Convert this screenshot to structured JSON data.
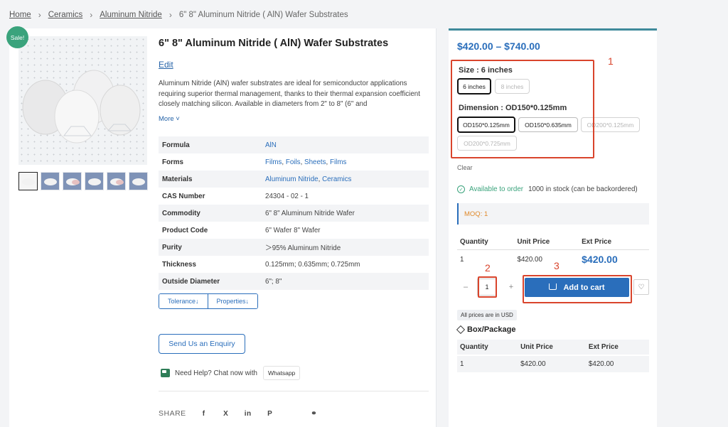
{
  "breadcrumb": {
    "home": "Home",
    "sep": "›",
    "ceramics": "Ceramics",
    "aluminum_nitride": "Aluminum Nitride",
    "current": "6\" 8\" Aluminum Nitride ( AlN) Wafer Substrates"
  },
  "badge": {
    "sale": "Sale!"
  },
  "product": {
    "title": "6\" 8\" Aluminum Nitride ( AlN) Wafer Substrates",
    "edit_label": "Edit",
    "description": "Aluminum Nitride (AlN) wafer substrates are ideal for semiconductor applications requiring superior thermal management, thanks to their thermal expansion coefficient closely matching silicon. Available in diameters from 2\" to 8\" (6\" and",
    "more_label": "More ˅"
  },
  "specs": {
    "formula": {
      "label": "Formula",
      "value": "AlN"
    },
    "forms": {
      "label": "Forms",
      "v1": "Films",
      "v2": "Foils",
      "v3": "Sheets",
      "v4": "Films",
      "comma": ","
    },
    "materials": {
      "label": "Materials",
      "v1": "Aluminum Nitride",
      "v2": "Ceramics"
    },
    "cas": {
      "label": "CAS Number",
      "value": "24304 - 02 - 1"
    },
    "commodity": {
      "label": "Commodity",
      "value": "6\" 8\" Aluminum Nitride Wafer"
    },
    "product_code": {
      "label": "Product Code",
      "value": "6\" Wafer 8\" Wafer"
    },
    "purity": {
      "label": "Purity",
      "value": "＞95% Aluminum Nitride"
    },
    "thickness": {
      "label": "Thickness",
      "value": "0.125mm; 0.635mm; 0.725mm"
    },
    "outside_diameter": {
      "label": "Outside Diameter",
      "value": "6\"; 8\""
    }
  },
  "tabs": {
    "tolerance": "Tolerance↓",
    "properties": "Properties↓"
  },
  "enquiry": {
    "label": "Send Us an Enquiry"
  },
  "help": {
    "text": "Need Help? Chat now with",
    "whatsapp": "Whatsapp"
  },
  "share": {
    "label": "SHARE",
    "facebook": "f",
    "x": "X",
    "linkedin": "in",
    "pinterest": "P",
    "link": "⚭"
  },
  "pricing": {
    "range": "$420.00 – $740.00"
  },
  "variations": {
    "size_label": "Size : 6 inches",
    "size_options": [
      "6 inches",
      "8 inches"
    ],
    "dimension_label": "Dimension : OD150*0.125mm",
    "dimension_options": [
      "OD150*0.125mm",
      "OD150*0.635mm",
      "OD200*0.125mm",
      "OD200*0.725mm"
    ],
    "clear": "Clear"
  },
  "stock": {
    "check": "✓",
    "status": "Available to order",
    "qty": "1000 in stock (can be backordered)"
  },
  "moq": {
    "text": "MOQ: 1"
  },
  "qty_table": {
    "headers": [
      "Quantity",
      "Unit Price",
      "Ext Price"
    ],
    "row": {
      "quantity": "1",
      "unit_price": "$420.00",
      "ext_price": "$420.00"
    }
  },
  "cart": {
    "minus": "–",
    "qty": "1",
    "plus": "+",
    "add_label": "Add to cart",
    "wishlist": "♡"
  },
  "currency_note": "All prices are in USD",
  "box_package": {
    "title": "Box/Package",
    "headers": [
      "Quantity",
      "Unit Price",
      "Ext Price"
    ],
    "row": {
      "quantity": "1",
      "unit_price": "$420.00",
      "ext_price": "$420.00"
    }
  },
  "annotations": {
    "n1": "1",
    "n2": "2",
    "n3": "3"
  },
  "colors": {
    "brand_blue": "#2a6ebb",
    "annotation_red": "#d9442c",
    "sale_green": "#3aa37c",
    "moq_orange": "#e08a2c"
  }
}
